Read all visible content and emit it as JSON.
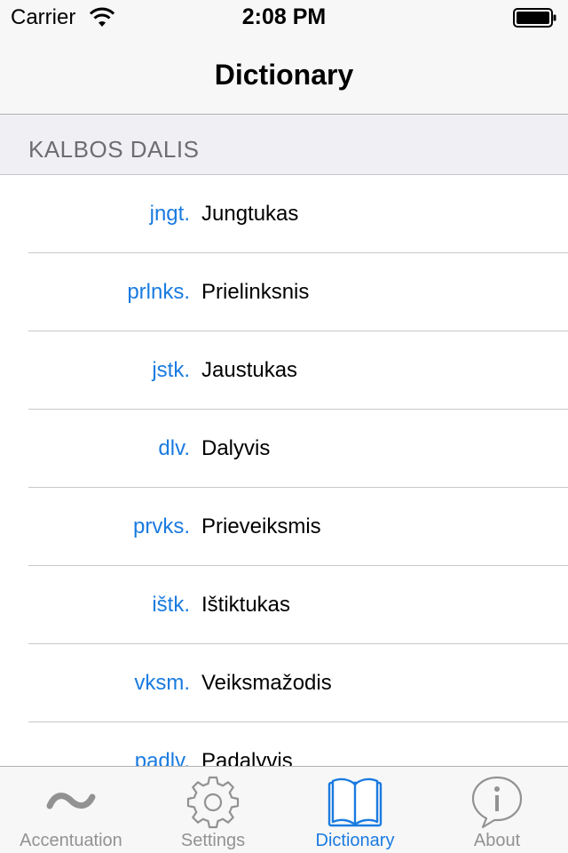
{
  "status_bar": {
    "carrier": "Carrier",
    "time": "2:08 PM"
  },
  "nav": {
    "title": "Dictionary"
  },
  "section": {
    "header": "KALBOS DALIS"
  },
  "rows": [
    {
      "abbr": "jngt.",
      "word": "Jungtukas"
    },
    {
      "abbr": "prlnks.",
      "word": "Prielinksnis"
    },
    {
      "abbr": "jstk.",
      "word": "Jaustukas"
    },
    {
      "abbr": "dlv.",
      "word": "Dalyvis"
    },
    {
      "abbr": "prvks.",
      "word": "Prieveiksmis"
    },
    {
      "abbr": "ištk.",
      "word": "Ištiktukas"
    },
    {
      "abbr": "vksm.",
      "word": "Veiksmažodis"
    },
    {
      "abbr": "padlv.",
      "word": "Padalyvis"
    }
  ],
  "tabs": [
    {
      "label": "Accentuation",
      "icon": "tilde-icon",
      "active": false
    },
    {
      "label": "Settings",
      "icon": "gear-icon",
      "active": false
    },
    {
      "label": "Dictionary",
      "icon": "book-icon",
      "active": true
    },
    {
      "label": "About",
      "icon": "info-icon",
      "active": false
    }
  ],
  "colors": {
    "accent": "#1a7be0",
    "inactive_tab": "#929292",
    "section_bg": "#efeff4",
    "bar_bg": "#f7f7f7"
  }
}
